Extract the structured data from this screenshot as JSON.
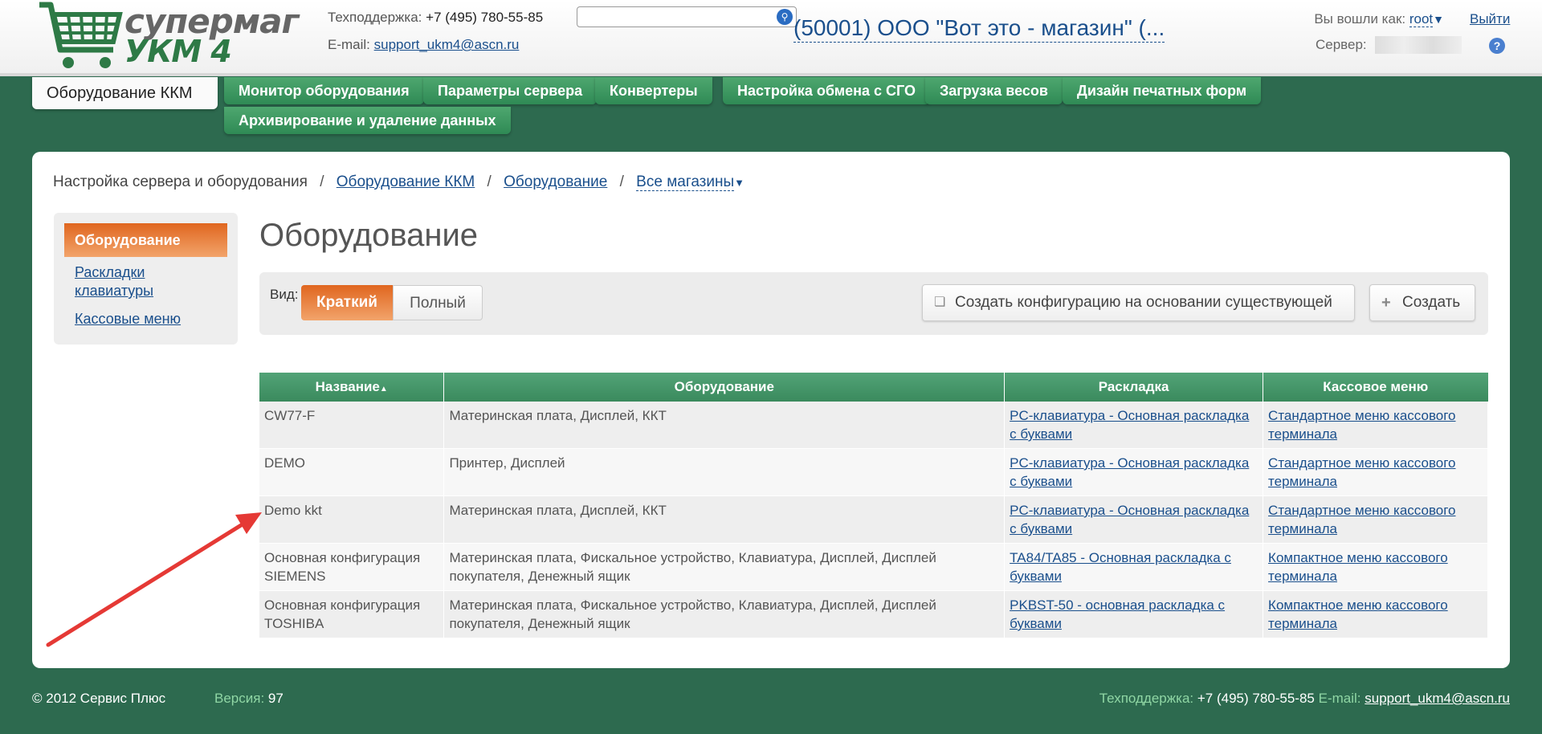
{
  "header": {
    "logo_line1": "супермаг",
    "logo_line2": "УКМ 4",
    "support_label": "Техподдержка:",
    "support_phone": "+7 (495) 780-55-85",
    "email_label": "E-mail:",
    "email": "support_ukm4@ascn.ru",
    "search_placeholder": "",
    "store_name": "(50001) ООО \"Вот это - магазин\" (...",
    "logged_as_label": "Вы вошли как:",
    "user": "root",
    "server_label": "Сервер:",
    "logout": "Выйти",
    "help": "?"
  },
  "nav": {
    "tabs": [
      "Оборудование ККМ",
      "Монитор оборудования",
      "Параметры сервера",
      "Конвертеры",
      "Настройка обмена с СГО",
      "Загрузка весов",
      "Дизайн печатных форм",
      "Архивирование и удаление данных"
    ]
  },
  "breadcrumb": {
    "root": "Настройка сервера и оборудования",
    "sep": "/",
    "link1": "Оборудование ККМ",
    "link2": "Оборудование",
    "dropdown": "Все магазины"
  },
  "sidebar": {
    "items": [
      "Оборудование",
      "Раскладки клавиатуры",
      "Кассовые меню"
    ]
  },
  "page": {
    "title": "Оборудование"
  },
  "toolbar": {
    "view_label": "Вид:",
    "view_short": "Краткий",
    "view_full": "Полный",
    "create_from": "Создать конфигурацию на основании существующей",
    "create": "Создать"
  },
  "table": {
    "headers": [
      "Название",
      "Оборудование",
      "Раскладка",
      "Кассовое меню"
    ],
    "rows": [
      {
        "name": "CW77-F",
        "equipment": "Материнская плата, Дисплей, ККТ",
        "layout": "PC-клавиатура - Основная раскладка с буквами",
        "menu": "Стандартное меню кассового терминала"
      },
      {
        "name": "DEMO",
        "equipment": "Принтер, Дисплей",
        "layout": "PC-клавиатура - Основная раскладка с буквами",
        "menu": "Стандартное меню кассового терминала"
      },
      {
        "name": "Demo kkt",
        "equipment": "Материнская плата, Дисплей, ККТ",
        "layout": "PC-клавиатура - Основная раскладка с буквами",
        "menu": "Стандартное меню кассового терминала"
      },
      {
        "name": "Основная конфигурация SIEMENS",
        "equipment": "Материнская плата, Фискальное устройство, Клавиатура, Дисплей, Дисплей покупателя, Денежный ящик",
        "layout": "TA84/TA85 - Основная раскладка с буквами",
        "menu": "Компактное меню кассового терминала"
      },
      {
        "name": "Основная конфигурация TOSHIBA",
        "equipment": "Материнская плата, Фискальное устройство, Клавиатура, Дисплей, Дисплей покупателя, Денежный ящик",
        "layout": "PKBST-50 - основная раскладка с буквами",
        "menu": "Компактное меню кассового терминала"
      }
    ]
  },
  "footer": {
    "copyright": "© 2012 Сервис Плюс",
    "version_label": "Версия:",
    "version": "97",
    "support_label": "Техподдержка:",
    "support_phone": "+7 (495) 780-55-85",
    "email_label": "E-mail:",
    "email": "support_ukm4@ascn.ru"
  },
  "colors": {
    "brand_green": "#2d6a4f",
    "tab_green": "#3a8a5d",
    "accent_orange": "#e0661f",
    "link_blue": "#1a4f8c",
    "annotation_arrow": "#e53935"
  }
}
